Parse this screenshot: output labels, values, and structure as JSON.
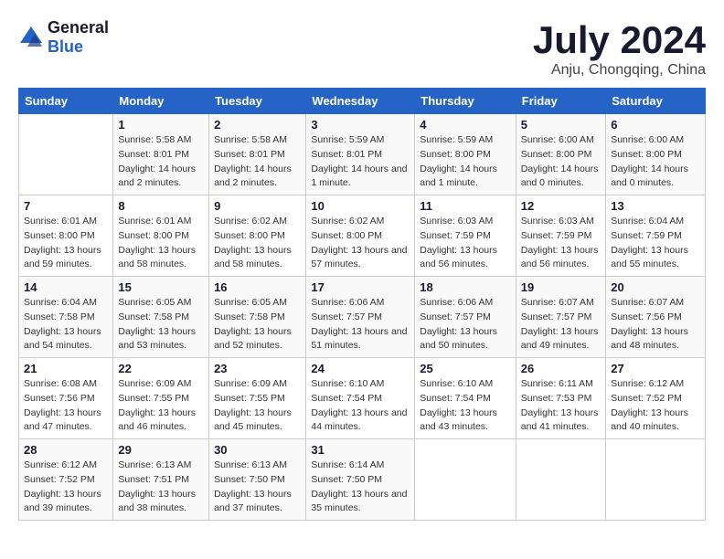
{
  "header": {
    "logo_general": "General",
    "logo_blue": "Blue",
    "title": "July 2024",
    "subtitle": "Anju, Chongqing, China"
  },
  "calendar": {
    "days_of_week": [
      "Sunday",
      "Monday",
      "Tuesday",
      "Wednesday",
      "Thursday",
      "Friday",
      "Saturday"
    ],
    "weeks": [
      [
        {
          "day": "",
          "sunrise": "",
          "sunset": "",
          "daylight": ""
        },
        {
          "day": "1",
          "sunrise": "Sunrise: 5:58 AM",
          "sunset": "Sunset: 8:01 PM",
          "daylight": "Daylight: 14 hours and 2 minutes."
        },
        {
          "day": "2",
          "sunrise": "Sunrise: 5:58 AM",
          "sunset": "Sunset: 8:01 PM",
          "daylight": "Daylight: 14 hours and 2 minutes."
        },
        {
          "day": "3",
          "sunrise": "Sunrise: 5:59 AM",
          "sunset": "Sunset: 8:01 PM",
          "daylight": "Daylight: 14 hours and 1 minute."
        },
        {
          "day": "4",
          "sunrise": "Sunrise: 5:59 AM",
          "sunset": "Sunset: 8:00 PM",
          "daylight": "Daylight: 14 hours and 1 minute."
        },
        {
          "day": "5",
          "sunrise": "Sunrise: 6:00 AM",
          "sunset": "Sunset: 8:00 PM",
          "daylight": "Daylight: 14 hours and 0 minutes."
        },
        {
          "day": "6",
          "sunrise": "Sunrise: 6:00 AM",
          "sunset": "Sunset: 8:00 PM",
          "daylight": "Daylight: 14 hours and 0 minutes."
        }
      ],
      [
        {
          "day": "7",
          "sunrise": "Sunrise: 6:01 AM",
          "sunset": "Sunset: 8:00 PM",
          "daylight": "Daylight: 13 hours and 59 minutes."
        },
        {
          "day": "8",
          "sunrise": "Sunrise: 6:01 AM",
          "sunset": "Sunset: 8:00 PM",
          "daylight": "Daylight: 13 hours and 58 minutes."
        },
        {
          "day": "9",
          "sunrise": "Sunrise: 6:02 AM",
          "sunset": "Sunset: 8:00 PM",
          "daylight": "Daylight: 13 hours and 58 minutes."
        },
        {
          "day": "10",
          "sunrise": "Sunrise: 6:02 AM",
          "sunset": "Sunset: 8:00 PM",
          "daylight": "Daylight: 13 hours and 57 minutes."
        },
        {
          "day": "11",
          "sunrise": "Sunrise: 6:03 AM",
          "sunset": "Sunset: 7:59 PM",
          "daylight": "Daylight: 13 hours and 56 minutes."
        },
        {
          "day": "12",
          "sunrise": "Sunrise: 6:03 AM",
          "sunset": "Sunset: 7:59 PM",
          "daylight": "Daylight: 13 hours and 56 minutes."
        },
        {
          "day": "13",
          "sunrise": "Sunrise: 6:04 AM",
          "sunset": "Sunset: 7:59 PM",
          "daylight": "Daylight: 13 hours and 55 minutes."
        }
      ],
      [
        {
          "day": "14",
          "sunrise": "Sunrise: 6:04 AM",
          "sunset": "Sunset: 7:58 PM",
          "daylight": "Daylight: 13 hours and 54 minutes."
        },
        {
          "day": "15",
          "sunrise": "Sunrise: 6:05 AM",
          "sunset": "Sunset: 7:58 PM",
          "daylight": "Daylight: 13 hours and 53 minutes."
        },
        {
          "day": "16",
          "sunrise": "Sunrise: 6:05 AM",
          "sunset": "Sunset: 7:58 PM",
          "daylight": "Daylight: 13 hours and 52 minutes."
        },
        {
          "day": "17",
          "sunrise": "Sunrise: 6:06 AM",
          "sunset": "Sunset: 7:57 PM",
          "daylight": "Daylight: 13 hours and 51 minutes."
        },
        {
          "day": "18",
          "sunrise": "Sunrise: 6:06 AM",
          "sunset": "Sunset: 7:57 PM",
          "daylight": "Daylight: 13 hours and 50 minutes."
        },
        {
          "day": "19",
          "sunrise": "Sunrise: 6:07 AM",
          "sunset": "Sunset: 7:57 PM",
          "daylight": "Daylight: 13 hours and 49 minutes."
        },
        {
          "day": "20",
          "sunrise": "Sunrise: 6:07 AM",
          "sunset": "Sunset: 7:56 PM",
          "daylight": "Daylight: 13 hours and 48 minutes."
        }
      ],
      [
        {
          "day": "21",
          "sunrise": "Sunrise: 6:08 AM",
          "sunset": "Sunset: 7:56 PM",
          "daylight": "Daylight: 13 hours and 47 minutes."
        },
        {
          "day": "22",
          "sunrise": "Sunrise: 6:09 AM",
          "sunset": "Sunset: 7:55 PM",
          "daylight": "Daylight: 13 hours and 46 minutes."
        },
        {
          "day": "23",
          "sunrise": "Sunrise: 6:09 AM",
          "sunset": "Sunset: 7:55 PM",
          "daylight": "Daylight: 13 hours and 45 minutes."
        },
        {
          "day": "24",
          "sunrise": "Sunrise: 6:10 AM",
          "sunset": "Sunset: 7:54 PM",
          "daylight": "Daylight: 13 hours and 44 minutes."
        },
        {
          "day": "25",
          "sunrise": "Sunrise: 6:10 AM",
          "sunset": "Sunset: 7:54 PM",
          "daylight": "Daylight: 13 hours and 43 minutes."
        },
        {
          "day": "26",
          "sunrise": "Sunrise: 6:11 AM",
          "sunset": "Sunset: 7:53 PM",
          "daylight": "Daylight: 13 hours and 41 minutes."
        },
        {
          "day": "27",
          "sunrise": "Sunrise: 6:12 AM",
          "sunset": "Sunset: 7:52 PM",
          "daylight": "Daylight: 13 hours and 40 minutes."
        }
      ],
      [
        {
          "day": "28",
          "sunrise": "Sunrise: 6:12 AM",
          "sunset": "Sunset: 7:52 PM",
          "daylight": "Daylight: 13 hours and 39 minutes."
        },
        {
          "day": "29",
          "sunrise": "Sunrise: 6:13 AM",
          "sunset": "Sunset: 7:51 PM",
          "daylight": "Daylight: 13 hours and 38 minutes."
        },
        {
          "day": "30",
          "sunrise": "Sunrise: 6:13 AM",
          "sunset": "Sunset: 7:50 PM",
          "daylight": "Daylight: 13 hours and 37 minutes."
        },
        {
          "day": "31",
          "sunrise": "Sunrise: 6:14 AM",
          "sunset": "Sunset: 7:50 PM",
          "daylight": "Daylight: 13 hours and 35 minutes."
        },
        {
          "day": "",
          "sunrise": "",
          "sunset": "",
          "daylight": ""
        },
        {
          "day": "",
          "sunrise": "",
          "sunset": "",
          "daylight": ""
        },
        {
          "day": "",
          "sunrise": "",
          "sunset": "",
          "daylight": ""
        }
      ]
    ]
  }
}
